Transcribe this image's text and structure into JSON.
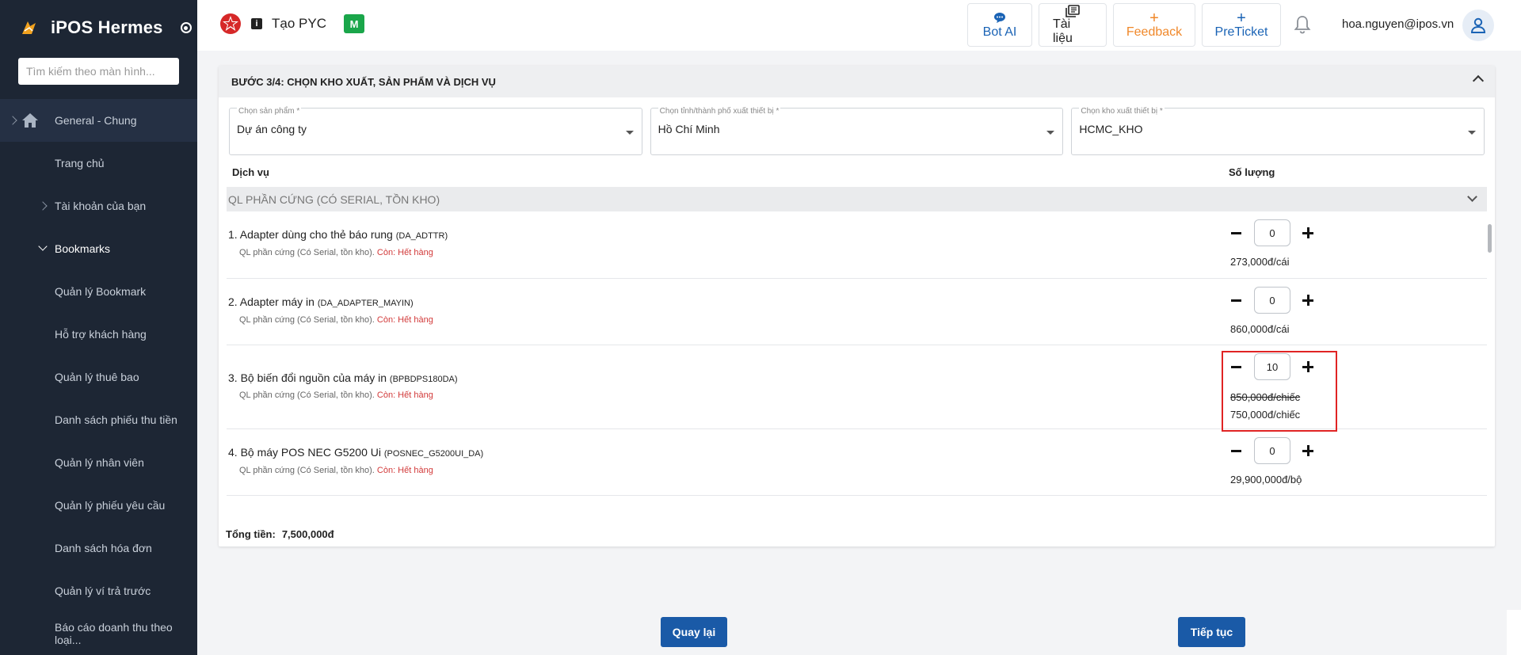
{
  "sidebar": {
    "brand": "iPOS Hermes",
    "search_placeholder": "Tìm kiếm theo màn hình...",
    "items": [
      {
        "label": "General - Chung"
      },
      {
        "label": "Trang chủ"
      },
      {
        "label": "Tài khoản của bạn"
      },
      {
        "label": "Bookmarks"
      },
      {
        "label": "Quản lý Bookmark"
      },
      {
        "label": "Hỗ trợ khách hàng"
      },
      {
        "label": "Quản lý thuê bao"
      },
      {
        "label": "Danh sách phiếu thu tiền"
      },
      {
        "label": "Quản lý nhân viên"
      },
      {
        "label": "Quản lý phiếu yêu cầu"
      },
      {
        "label": "Danh sách hóa đơn"
      },
      {
        "label": "Quản lý ví trả trước"
      },
      {
        "label": "Báo cáo doanh thu theo loại..."
      }
    ]
  },
  "header": {
    "title": "Tạo PYC",
    "badge": "M",
    "actions": {
      "bot": "Bot AI",
      "docs": "Tài liệu",
      "feedback": "Feedback",
      "preticket": "PreTicket"
    },
    "user_email": "hoa.nguyen@ipos.vn"
  },
  "step": {
    "title": "BƯỚC 3/4: CHỌN KHO XUẤT, SẢN PHẨM VÀ DỊCH VỤ",
    "product_label": "Chọn sản phẩm *",
    "product_value": "Dự án công ty",
    "city_label": "Chọn tỉnh/thành phố xuất thiết bị *",
    "city_value": "Hồ Chí Minh",
    "warehouse_label": "Chọn kho xuất thiết bị *",
    "warehouse_value": "HCMC_KHO",
    "col_service": "Dịch vụ",
    "col_qty": "Số lượng",
    "group_label": "QL PHẦN CỨNG (CÓ SERIAL, TỒN KHO)",
    "stock_prefix": "QL phần cứng (Có Serial, tồn kho).",
    "stock_status": "Còn: Hết hàng",
    "items": [
      {
        "name": "1. Adapter dùng cho thẻ báo rung",
        "code": "(DA_ADTTR)",
        "qty": "0",
        "price": "273,000đ/cái"
      },
      {
        "name": "2. Adapter máy in",
        "code": "(DA_ADAPTER_MAYIN)",
        "qty": "0",
        "price": "860,000đ/cái"
      },
      {
        "name": "3. Bộ biến đổi nguồn của máy in",
        "code": "(BPBDPS180DA)",
        "qty": "10",
        "old_price": "850,000đ/chiếc",
        "price": "750,000đ/chiếc"
      },
      {
        "name": "4. Bộ máy POS NEC G5200 Ui",
        "code": "(POSNEC_G5200UI_DA)",
        "qty": "0",
        "price": "29,900,000đ/bộ"
      }
    ],
    "total_label": "Tổng tiền:",
    "total_value": "7,500,000đ"
  },
  "footer": {
    "back": "Quay lại",
    "next": "Tiếp tục"
  },
  "colors": {
    "sidebar_bg": "#1d2634",
    "primary": "#1a5aa7",
    "feedback": "#f0882a",
    "out_of_stock": "#d23a3a",
    "highlight": "#e02424"
  }
}
